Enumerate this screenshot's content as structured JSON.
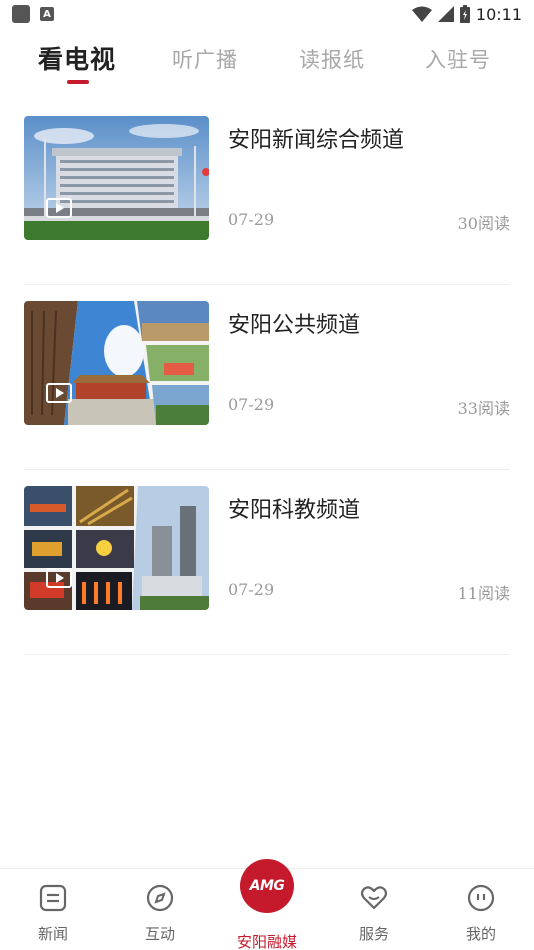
{
  "status_bar": {
    "time": "10:11",
    "notification_letter": "A"
  },
  "tabs": [
    {
      "label": "看电视",
      "active": true
    },
    {
      "label": "听广播",
      "active": false
    },
    {
      "label": "读报纸",
      "active": false
    },
    {
      "label": "入驻号",
      "active": false
    }
  ],
  "channels": [
    {
      "title": "安阳新闻综合频道",
      "date": "07-29",
      "reads": "30阅读",
      "thumbnail": "government-building-photo"
    },
    {
      "title": "安阳公共频道",
      "date": "07-29",
      "reads": "33阅读",
      "thumbnail": "city-collage-photo"
    },
    {
      "title": "安阳科教频道",
      "date": "07-29",
      "reads": "11阅读",
      "thumbnail": "industry-collage-photo"
    }
  ],
  "bottom_nav": [
    {
      "label": "新闻",
      "icon": "news-icon"
    },
    {
      "label": "互动",
      "icon": "compass-icon"
    },
    {
      "label": "安阳融媒",
      "icon": "amg-logo",
      "logo_text": "AMG",
      "active": true
    },
    {
      "label": "服务",
      "icon": "heart-icon"
    },
    {
      "label": "我的",
      "icon": "profile-icon"
    }
  ],
  "colors": {
    "accent": "#c41a2b",
    "inactive_tab": "#a8a8a8",
    "meta_text": "#9a9a9a"
  }
}
